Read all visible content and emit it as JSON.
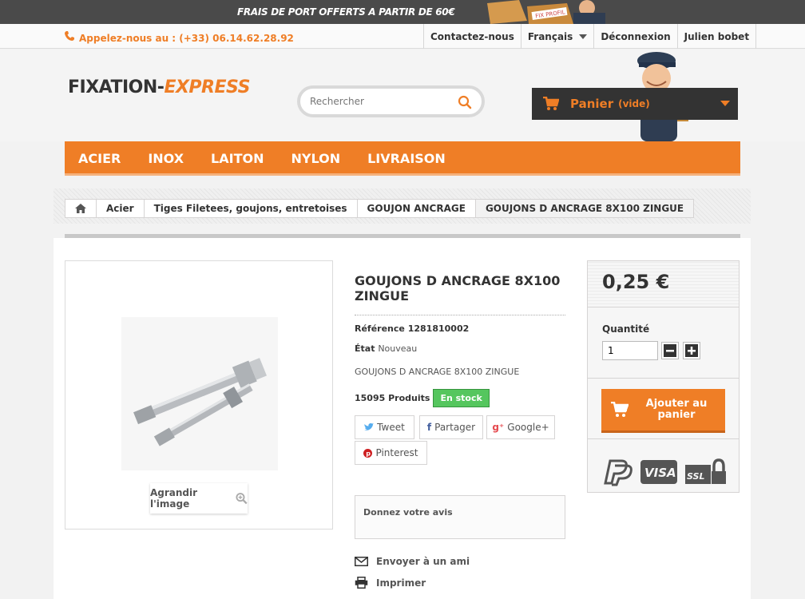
{
  "promo": {
    "text": "FRAIS DE PORT OFFERTS A PARTIR DE 60€",
    "box_label": "FIX PROFIL"
  },
  "topbar": {
    "phone": "Appelez-nous au : (+33) 06.14.62.28.92",
    "links": {
      "contact": "Contactez-nous",
      "language": "Français",
      "logout": "Déconnexion",
      "user": "Julien bobet"
    }
  },
  "header": {
    "logo_part1": "FIXATION-",
    "logo_part2": "EXPRESS",
    "search_placeholder": "Rechercher",
    "cart_label": "Panier",
    "cart_state": "(vide)"
  },
  "nav": {
    "items": [
      "ACIER",
      "INOX",
      "LAITON",
      "NYLON",
      "LIVRAISON"
    ]
  },
  "breadcrumb": [
    "Acier",
    "Tiges Filetees, goujons, entretoises",
    "GOUJON ANCRAGE",
    "GOUJONS D ANCRAGE 8X100 ZINGUE"
  ],
  "product": {
    "zoom_label": "Agrandir l'image",
    "title": "GOUJONS D ANCRAGE 8X100 ZINGUE",
    "reference_label": "Référence",
    "reference_value": "1281810002",
    "state_label": "État",
    "state_value": "Nouveau",
    "short_description": "GOUJONS D ANCRAGE 8X100 ZINGUE",
    "quantity_available": "15095 Produits",
    "stock_badge": "En stock",
    "share": {
      "tweet": "Tweet",
      "facebook": "Partager",
      "google": "Google+",
      "pinterest": "Pinterest"
    },
    "review": "Donnez votre avis",
    "send_friend": "Envoyer à un ami",
    "print": "Imprimer"
  },
  "buy": {
    "price": "0,25 €",
    "quantity_label": "Quantité",
    "quantity_value": "1",
    "add_to_cart": "Ajouter au panier",
    "payment_logos": [
      "PayPal",
      "VISA",
      "SSL"
    ]
  },
  "colors": {
    "accent": "#ef7e26",
    "dark": "#333333",
    "stock_green": "#55c65e"
  }
}
